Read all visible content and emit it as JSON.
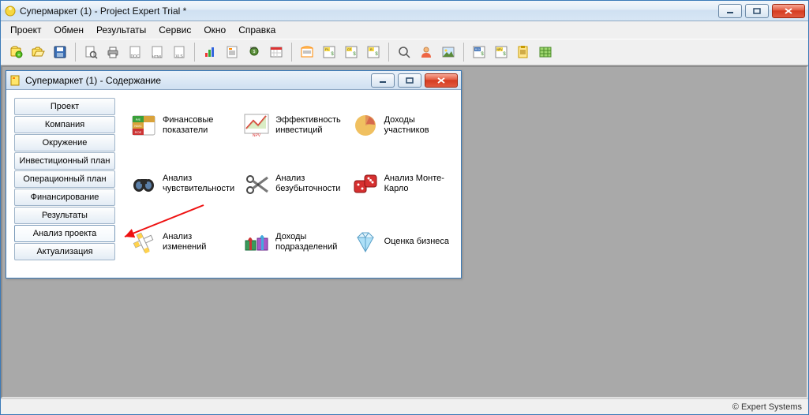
{
  "app": {
    "title": "Супермаркет (1) - Project Expert Trial *"
  },
  "menu": {
    "items": [
      "Проект",
      "Обмен",
      "Результаты",
      "Сервис",
      "Окно",
      "Справка"
    ]
  },
  "toolbar": {
    "groups": [
      [
        "new-project",
        "open-project",
        "save"
      ],
      [
        "preview",
        "print",
        "word",
        "html",
        "excel"
      ],
      [
        "chart",
        "content-list",
        "cost",
        "calendar"
      ],
      [
        "cashflow",
        "pl",
        "cf",
        "bs"
      ],
      [
        "zoom",
        "user",
        "picture"
      ],
      [
        "roi",
        "npv",
        "results",
        "table"
      ]
    ]
  },
  "child": {
    "title": "Супермаркет (1) - Содержание",
    "tabs": [
      "Проект",
      "Компания",
      "Окружение",
      "Инвестиционный план",
      "Операционный план",
      "Финансирование",
      "Результаты",
      "Анализ проекта",
      "Актуализация"
    ],
    "active_tab": 7,
    "items": [
      {
        "label": "Финансовые показатели"
      },
      {
        "label": "Эффективность инвестиций"
      },
      {
        "label": "Доходы участников"
      },
      {
        "label": "Анализ чувствительности"
      },
      {
        "label": "Анализ безубыточности"
      },
      {
        "label": "Анализ Монте-Карло"
      },
      {
        "label": "Анализ изменений"
      },
      {
        "label": "Доходы подразделений"
      },
      {
        "label": "Оценка бизнеса"
      }
    ]
  },
  "status": {
    "right": "© Expert Systems"
  }
}
